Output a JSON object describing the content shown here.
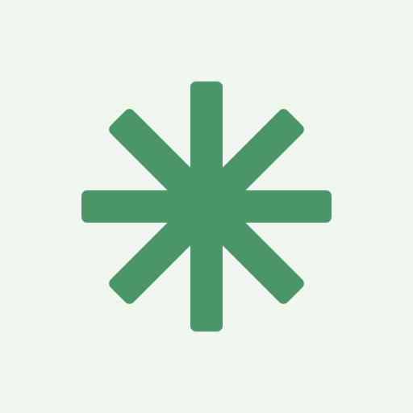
{
  "icon": {
    "name": "asterisk-icon",
    "background_color": "#eef6ef",
    "fill_color": "#4a9668"
  }
}
